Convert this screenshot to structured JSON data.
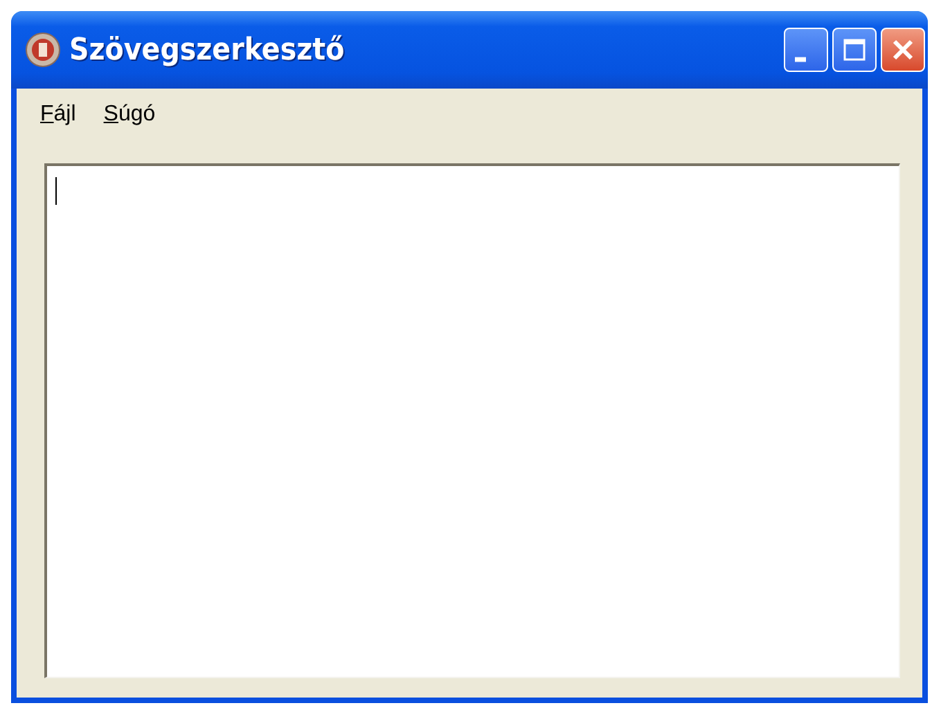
{
  "window": {
    "title": "Szövegszerkesztő"
  },
  "menu": [
    {
      "label": "Fájl"
    },
    {
      "label": "Súgó"
    }
  ],
  "editor": {
    "focused": true
  }
}
